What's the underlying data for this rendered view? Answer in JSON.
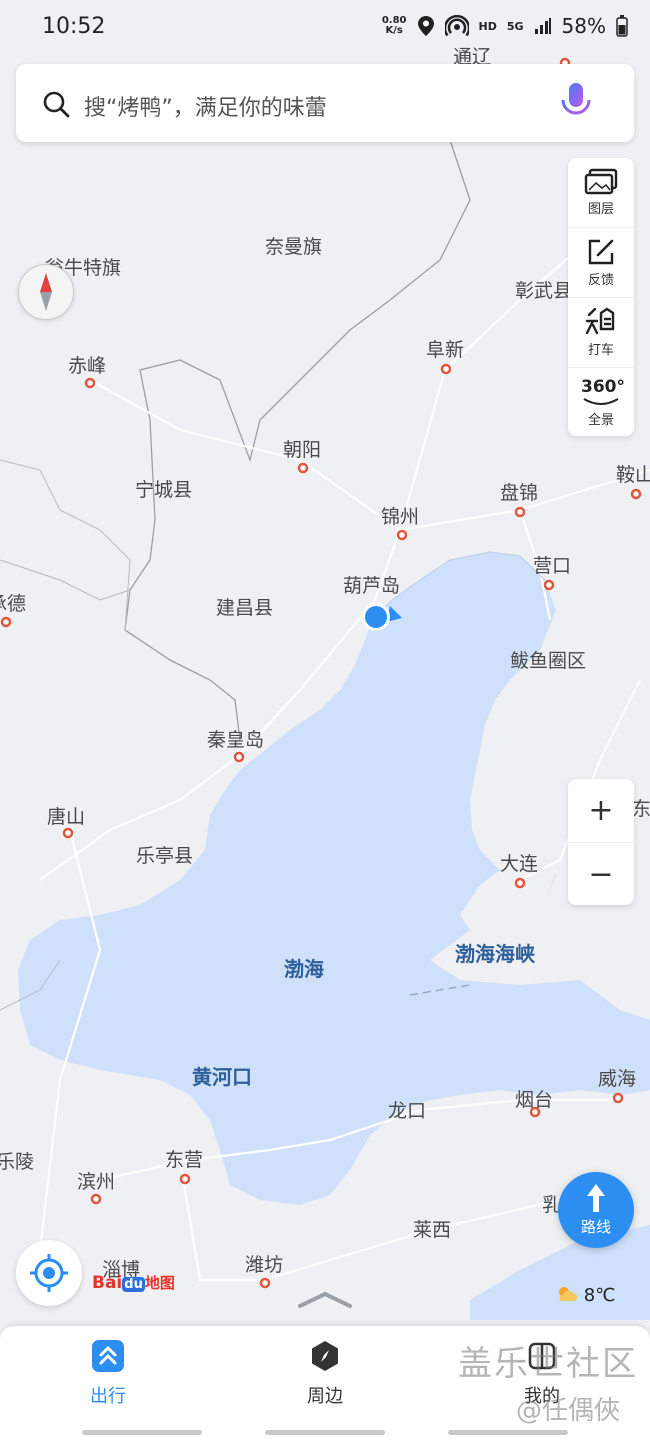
{
  "status_bar": {
    "time": "10:52",
    "net_speed_value": "0.80",
    "net_speed_unit": "K/s",
    "hd": "HD",
    "network": "5G",
    "battery": "58%"
  },
  "search": {
    "placeholder": "搜“烤鸭”，满足你的味蕾"
  },
  "right_panel": [
    {
      "label": "图层",
      "icon": "layers-icon"
    },
    {
      "label": "反馈",
      "icon": "feedback-icon"
    },
    {
      "label": "打车",
      "icon": "taxi-icon"
    },
    {
      "label": "全景",
      "icon": "panorama-icon",
      "badge": "360°"
    }
  ],
  "zoom": {
    "in": "+",
    "out": "−"
  },
  "map_labels": {
    "tongliao": "通辽",
    "naiman": "奈曼旗",
    "wengniute": "翁牛特旗",
    "zhangwu": "彰武县",
    "chifeng": "赤峰",
    "fuxin": "阜新",
    "chaoyang": "朝阳",
    "ningcheng": "宁城县",
    "jinzhou": "锦州",
    "panjin": "盘锦",
    "anshan": "鞍山",
    "yingkou": "营口",
    "huludao": "葫芦岛",
    "jianchang": "建昌县",
    "chengde": "承德",
    "bayuquan": "鲅鱼圈区",
    "qinhuangdao": "秦皇岛",
    "tangshan": "唐山",
    "laoting": "乐亭县",
    "dalian": "大连",
    "donghai": "东海",
    "bohai": "渤海",
    "bohai_strait": "渤海海峡",
    "huanghekou": "黄河口",
    "longkou": "龙口",
    "yantai": "烟台",
    "weihai": "威海",
    "leling": "乐陵",
    "binzhou": "滨州",
    "dongying": "东营",
    "rushan": "乳",
    "laixi": "莱西",
    "zibo": "淄博",
    "weifang": "潍坊"
  },
  "logo": {
    "prefix": "Bai",
    "middle": "du",
    "suffix": "地图"
  },
  "weather": {
    "temp": "8℃"
  },
  "route_button": {
    "label": "路线"
  },
  "tabs": [
    {
      "label": "出行",
      "active": true
    },
    {
      "label": "周边",
      "active": false
    },
    {
      "label": "我的",
      "active": false
    }
  ],
  "watermark": {
    "line1": "盖乐世社区",
    "line2": "@任偶俠"
  },
  "colors": {
    "accent": "#2b8ef0",
    "sea": "#cfe0fa",
    "land": "#eef0f3",
    "city_dot": "#e0573d",
    "sea_label": "#2f5f9a"
  }
}
